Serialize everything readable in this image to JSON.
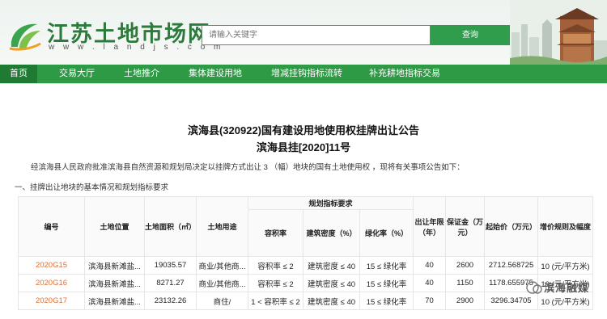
{
  "header": {
    "site_name": "江苏土地市场网",
    "site_url": "w w w . l a n d j s . c o m",
    "search_placeholder": "请输入关键字",
    "search_button": "查询"
  },
  "nav": {
    "items": [
      "首页",
      "交易大厅",
      "土地推介",
      "集体建设用地",
      "增减挂钩指标流转",
      "补充耕地指标交易"
    ],
    "active_index": 0
  },
  "notice": {
    "title": "滨海县(320922)国有建设用地使用权挂牌出让公告",
    "subtitle": "滨海县挂[2020]11号",
    "intro": "经滨海县人民政府批准滨海县自然资源和规划局决定以挂牌方式出让 3 （幅）地块的国有土地使用权 ，现将有关事项公告如下：",
    "section_1": "一、挂牌出让地块的基本情况和规划指标要求"
  },
  "table": {
    "headers": {
      "id": "编号",
      "location": "土地位置",
      "area": "土地面积（㎡）",
      "use": "土地用途",
      "plan_group": "规划指标要求",
      "far": "容积率",
      "density": "建筑密度（%）",
      "green": "绿化率（%）",
      "years": "出让年限（年）",
      "deposit": "保证金（万元）",
      "start_price": "起始价（万元）",
      "increment": "增价规则及幅度"
    },
    "rows": [
      {
        "id": "2020G15",
        "location": "滨海县新滩盐...",
        "area": "19035.57",
        "use": "商业/其他商...",
        "far": "容积率 ≤ 2",
        "density": "建筑密度 ≤ 40",
        "green": "15 ≤ 绿化率",
        "years": "40",
        "deposit": "2600",
        "start_price": "2712.568725",
        "increment": "10 (元/平方米)"
      },
      {
        "id": "2020G16",
        "location": "滨海县新滩盐...",
        "area": "8271.27",
        "use": "商业/其他商...",
        "far": "容积率 ≤ 2",
        "density": "建筑密度 ≤ 40",
        "green": "15 ≤ 绿化率",
        "years": "40",
        "deposit": "1150",
        "start_price": "1178.655975",
        "increment": "10 (元/平方米)"
      },
      {
        "id": "2020G17",
        "location": "滨海县新滩盐...",
        "area": "23132.26",
        "use": "商住/",
        "far": "1 < 容积率 ≤ 2",
        "density": "建筑密度 ≤ 40",
        "green": "15 ≤ 绿化率",
        "years": "70",
        "deposit": "2900",
        "start_price": "3296.34705",
        "increment": "10 (元/平方米)"
      }
    ]
  },
  "watermark": "滨海融媒",
  "colors": {
    "brand_green": "#2f9a46",
    "active_nav": "#1f7a34",
    "link_orange": "#e07030"
  }
}
